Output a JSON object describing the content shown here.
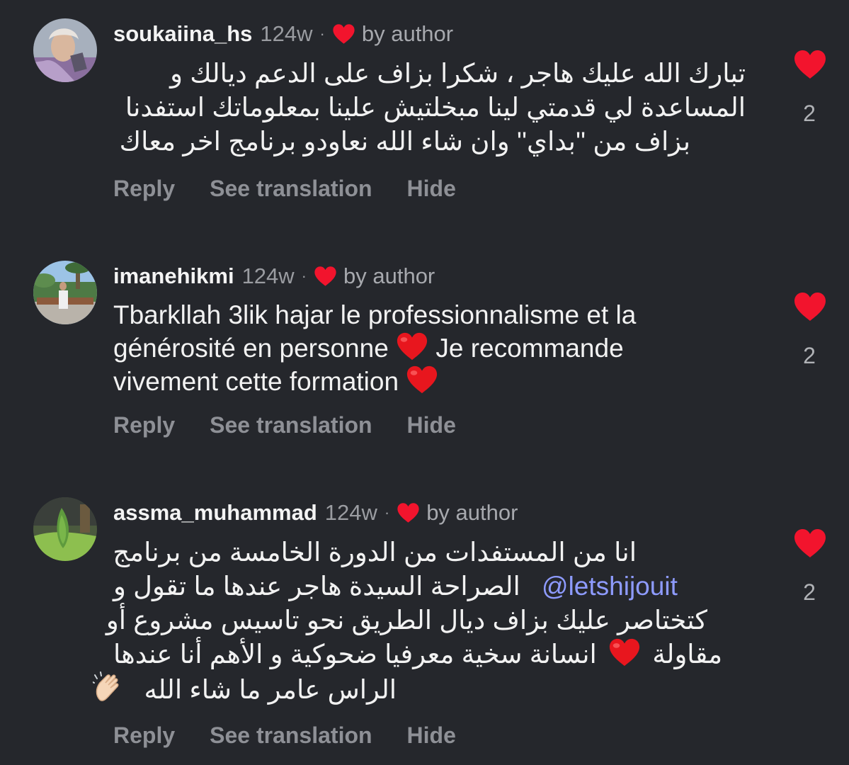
{
  "comments": [
    {
      "username": "soukaiina_hs",
      "age": "124w",
      "dot": "·",
      "by_author": "by author",
      "lines": [
        "تبارك الله عليك هاجر ، شكرا بزاف على الدعم ديالك و",
        "المساعدة لي قدمتي لينا مبخلتيش علينا بمعلوماتك استفدنا",
        "بزاف من ''بداي'' وان شاء الله نعاودو برنامج اخر معاك"
      ],
      "actions": {
        "reply": "Reply",
        "translate": "See translation",
        "hide": "Hide"
      },
      "likes": "2"
    },
    {
      "username": "imanehikmi",
      "age": "124w",
      "dot": "·",
      "by_author": "by author",
      "line1": "Tbarkllah 3lik hajar le professionnalisme et la",
      "line2a": "générosité en personne",
      "line2b": "Je recommande",
      "line3": "vivement cette formation",
      "actions": {
        "reply": "Reply",
        "translate": "See translation",
        "hide": "Hide"
      },
      "likes": "2"
    },
    {
      "username": "assma_muhammad",
      "age": "124w",
      "dot": "·",
      "by_author": "by author",
      "line1": "انا من المستفدات من الدورة الخامسة من برنامج",
      "line2_text": "الصراحة السيدة هاجر عندها ما تقول و",
      "line2_mention": "@letshijouit",
      "line3": "كتختاصر عليك بزاف ديال الطريق نحو تاسيس مشروع أو",
      "line4a": "مقاولة",
      "line4b": "انسانة سخية معرفيا ضحوكية و الأهم أنا عندها",
      "line5": "الراس عامر ما شاء الله",
      "actions": {
        "reply": "Reply",
        "translate": "See translation",
        "hide": "Hide"
      },
      "likes": "2"
    }
  ],
  "colors": {
    "background": "#25272c",
    "heart_red": "#f2142d",
    "mention": "#8e9bff",
    "muted": "#8e9096"
  },
  "icons": {
    "like": "heart-icon",
    "author_like": "heart-icon",
    "emoji": [
      "red-heart-emoji",
      "clapping-hands-emoji"
    ]
  }
}
